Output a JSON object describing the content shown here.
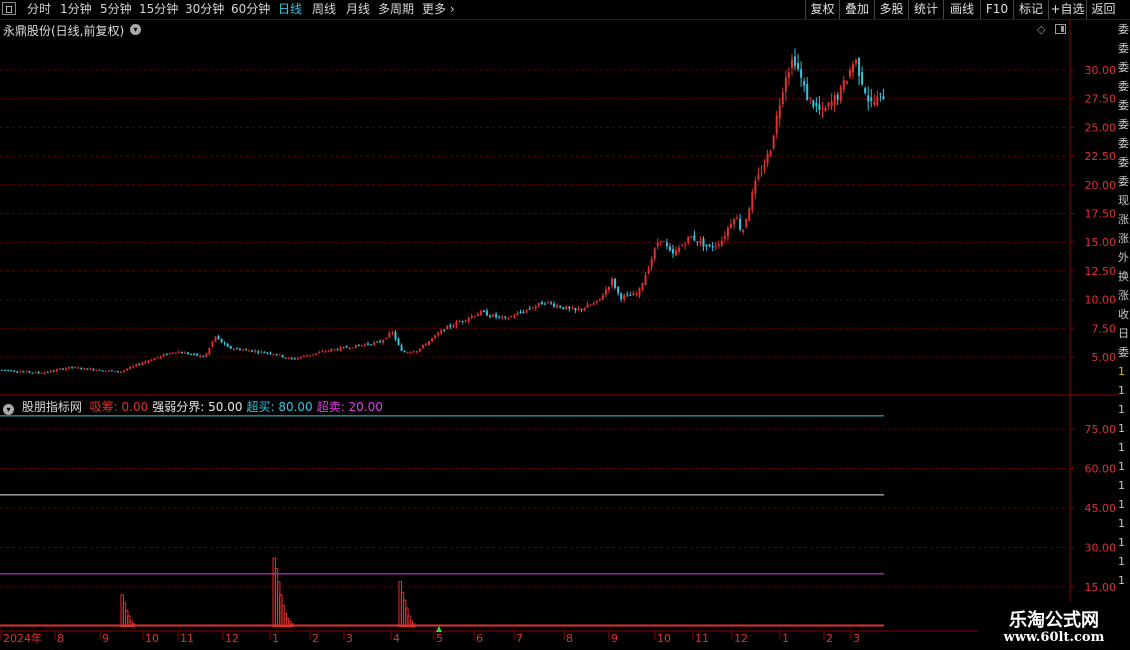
{
  "toolbar": {
    "timeframes": [
      {
        "label": "分时",
        "active": false
      },
      {
        "label": "1分钟",
        "active": false
      },
      {
        "label": "5分钟",
        "active": false
      },
      {
        "label": "15分钟",
        "active": false
      },
      {
        "label": "30分钟",
        "active": false
      },
      {
        "label": "60分钟",
        "active": false
      },
      {
        "label": "日线",
        "active": true
      },
      {
        "label": "周线",
        "active": false
      },
      {
        "label": "月线",
        "active": false
      },
      {
        "label": "多周期",
        "active": false
      },
      {
        "label": "更多",
        "active": false
      }
    ],
    "more_chevron": "›",
    "right_buttons": [
      "复权",
      "叠加",
      "多股",
      "统计",
      "画线",
      "F10",
      "标记",
      "+自选",
      "返回"
    ]
  },
  "chart_title": "永鼎股份(日线,前复权)",
  "price_axis_ticks": [
    "30.00",
    "27.50",
    "25.00",
    "22.50",
    "20.00",
    "17.50",
    "15.00",
    "12.50",
    "10.00",
    "7.50",
    "5.00"
  ],
  "indicator": {
    "name": "股朋指标网",
    "params": [
      {
        "label": "吸筹:",
        "value": "0.00",
        "color": "#e03030"
      },
      {
        "label": "强弱分界:",
        "value": "50.00",
        "color": "#e8e8e8"
      },
      {
        "label": "超买:",
        "value": "80.00",
        "color": "#36c5e0"
      },
      {
        "label": "超卖:",
        "value": "20.00",
        "color": "#e040e0"
      }
    ],
    "axis_ticks": [
      "75.00",
      "60.00",
      "45.00",
      "30.00",
      "15.00"
    ]
  },
  "date_axis": {
    "labels": [
      "2024年",
      "8",
      "9",
      "10",
      "11",
      "12",
      "1",
      "2",
      "3",
      "4",
      "5",
      "6",
      "7",
      "8",
      "9",
      "10",
      "11",
      "12",
      "1",
      "2",
      "3"
    ]
  },
  "right_strip_chars": [
    "委",
    "委",
    "委",
    "委",
    "委",
    "委",
    "委",
    "委",
    "委",
    "现",
    "涨",
    "涨",
    "外",
    "换",
    "涨",
    "收",
    "日",
    "委",
    "1",
    "1",
    "1",
    "1",
    "1",
    "1",
    "1",
    "1",
    "1",
    "1",
    "1",
    "1"
  ],
  "watermark": {
    "line1": "乐淘公式网",
    "line2": "www.60lt.com"
  },
  "colors": {
    "up": "#e03030",
    "down": "#36c5e0",
    "grid": "#5a0000",
    "axis": "#8b0000"
  },
  "chart_data": [
    {
      "type": "candlestick",
      "title": "永鼎股份(日线,前复权)",
      "ylim": [
        3,
        32
      ],
      "x_range": [
        "2024-07",
        "2025-03"
      ],
      "price_path": [
        [
          0,
          3.9
        ],
        [
          40,
          3.6
        ],
        [
          70,
          4.1
        ],
        [
          120,
          3.7
        ],
        [
          145,
          4.6
        ],
        [
          175,
          5.5
        ],
        [
          205,
          5.0
        ],
        [
          215,
          6.8
        ],
        [
          228,
          5.8
        ],
        [
          275,
          5.3
        ],
        [
          290,
          4.8
        ],
        [
          330,
          5.6
        ],
        [
          380,
          6.3
        ],
        [
          392,
          7.2
        ],
        [
          402,
          5.4
        ],
        [
          418,
          5.6
        ],
        [
          445,
          7.5
        ],
        [
          480,
          8.9
        ],
        [
          505,
          8.3
        ],
        [
          545,
          9.8
        ],
        [
          575,
          9.0
        ],
        [
          598,
          9.8
        ],
        [
          612,
          11.7
        ],
        [
          620,
          10.2
        ],
        [
          638,
          10.5
        ],
        [
          660,
          15.5
        ],
        [
          672,
          13.8
        ],
        [
          690,
          15.5
        ],
        [
          710,
          14.5
        ],
        [
          722,
          15.2
        ],
        [
          735,
          17.5
        ],
        [
          742,
          15.8
        ],
        [
          755,
          20.0
        ],
        [
          770,
          23.0
        ],
        [
          785,
          29.5
        ],
        [
          794,
          31.2
        ],
        [
          806,
          27.8
        ],
        [
          822,
          26.2
        ],
        [
          840,
          28.0
        ],
        [
          855,
          31.0
        ],
        [
          870,
          27.0
        ],
        [
          884,
          27.8
        ]
      ]
    },
    {
      "type": "line+bar",
      "title": "股朋指标网",
      "ylim": [
        0,
        90
      ],
      "lines": [
        {
          "name": "超买",
          "value": 80,
          "color": "#36c5e0"
        },
        {
          "name": "强弱分界",
          "value": 50,
          "color": "#e8e8e8"
        },
        {
          "name": "超卖",
          "value": 20,
          "color": "#e040e0"
        }
      ],
      "spikes": [
        {
          "x": 122,
          "values": [
            12,
            9,
            6,
            4,
            2,
            1
          ]
        },
        {
          "x": 274,
          "values": [
            26,
            22,
            17,
            12,
            8,
            5,
            3,
            2,
            1
          ]
        },
        {
          "x": 400,
          "values": [
            17,
            13,
            10,
            7,
            4,
            2,
            1
          ]
        }
      ]
    }
  ]
}
